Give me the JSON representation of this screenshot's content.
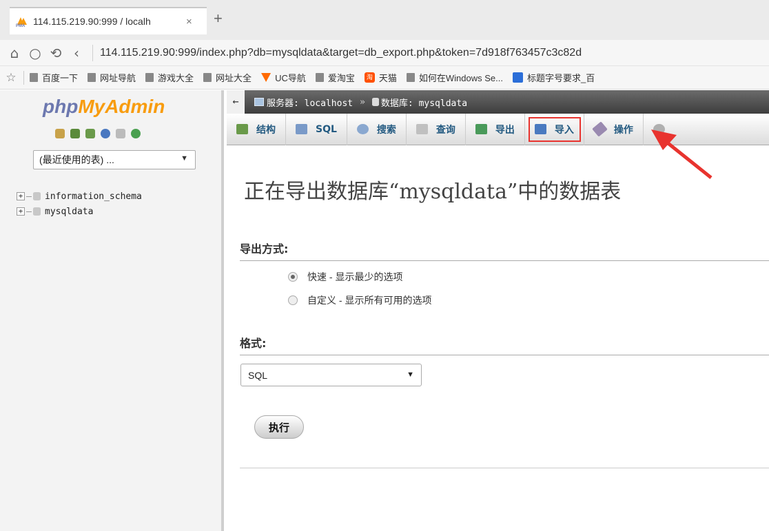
{
  "browser": {
    "tab_title": "114.115.219.90:999 / localh",
    "tab_close": "×",
    "new_tab": "+",
    "url": "114.115.219.90:999/index.php?db=mysqldata&target=db_export.php&token=7d918f763457c3c82d",
    "nav_icons": [
      "home-icon",
      "reload-icon",
      "undo-icon",
      "back-icon"
    ],
    "bookmarks": [
      {
        "label": "百度一下",
        "icon": "doc-icon"
      },
      {
        "label": "网址导航",
        "icon": "doc-icon"
      },
      {
        "label": "游戏大全",
        "icon": "doc-icon"
      },
      {
        "label": "网址大全",
        "icon": "doc-icon"
      },
      {
        "label": "UC导航",
        "icon": "uc-icon"
      },
      {
        "label": "爱淘宝",
        "icon": "doc-icon"
      },
      {
        "label": "天猫",
        "icon": "taobao-icon"
      },
      {
        "label": "如何在Windows Se...",
        "icon": "doc-icon"
      },
      {
        "label": "标题字号要求_百",
        "icon": "paw-icon"
      }
    ]
  },
  "sidebar": {
    "logo_php": "php",
    "logo_myadmin": "MyAdmin",
    "icon_colors": [
      "#c8a24a",
      "#5a8a3a",
      "#6a9a4a",
      "#4a78c0",
      "#bbbbbb",
      "#4aa050"
    ],
    "recent_tables_select": "(最近使用的表) ...",
    "databases": [
      {
        "name": "information_schema"
      },
      {
        "name": "mysqldata"
      }
    ]
  },
  "breadcrumb": {
    "server_label": "服务器: localhost",
    "separator": "»",
    "database_label": "数据库: mysqldata"
  },
  "topmenu": {
    "items": [
      {
        "label": "结构",
        "color": "#6a9a4a"
      },
      {
        "label": "SQL",
        "color": "#7a9ac8"
      },
      {
        "label": "搜索",
        "color": "#8aa8d0"
      },
      {
        "label": "查询",
        "color": "#c0c0c0"
      },
      {
        "label": "导出",
        "color": "#4a9a5a"
      },
      {
        "label": "导入",
        "color": "#4a7ac0"
      },
      {
        "label": "操作",
        "color": "#9a8ab0"
      }
    ],
    "highlight_color": "#e8332e"
  },
  "main": {
    "heading": "正在导出数据库“mysqldata”中的数据表",
    "export_method_title": "导出方式:",
    "options": [
      {
        "label": "快速 - 显示最少的选项",
        "checked": true
      },
      {
        "label": "自定义 - 显示所有可用的选项",
        "checked": false
      }
    ],
    "format_title": "格式:",
    "format_value": "SQL",
    "go_button": "执行"
  }
}
